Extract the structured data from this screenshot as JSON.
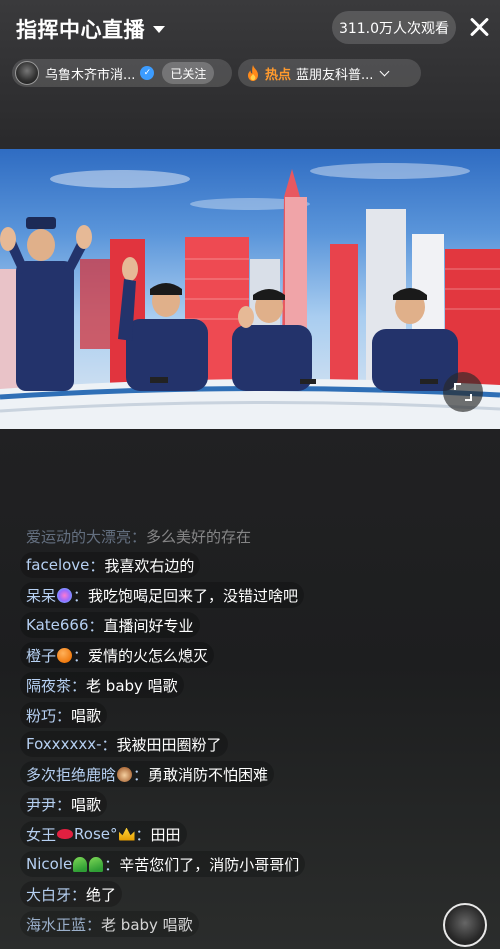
{
  "header": {
    "title": "指挥中心直播",
    "viewers": "311.0万人次观看"
  },
  "account": {
    "name": "乌鲁木齐市消...",
    "follow_label": "已关注"
  },
  "hot": {
    "label": "热点",
    "text": "蓝朋友科普..."
  },
  "icons": {
    "close": "close-icon",
    "dropdown": "caret-down-icon",
    "verified": "verified-icon",
    "fire": "fire-icon",
    "expand": "chevron-down-icon",
    "fullscreen": "fullscreen-icon"
  },
  "colors": {
    "username": "#b6d0f2",
    "hot_label": "#ff9a2e",
    "verified": "#3c9cff"
  },
  "comments": [
    {
      "user": "爱运动的大漂亮",
      "text": "多么美好的存在"
    },
    {
      "user": "facelove",
      "text": "我喜欢右边的"
    },
    {
      "user": "呆呆",
      "text": "我吃饱喝足回来了，没错过啥吧"
    },
    {
      "user": "Kate666",
      "text": "直播间好专业"
    },
    {
      "user": "橙子",
      "text": "爱情的火怎么熄灭"
    },
    {
      "user": "隔夜茶",
      "text": "老 baby 唱歌"
    },
    {
      "user": "粉巧",
      "text": "唱歌"
    },
    {
      "user": "Foxxxxxx-",
      "text": "我被田田圈粉了"
    },
    {
      "user": "多次拒绝鹿晗",
      "text": "勇敢消防不怕困难"
    },
    {
      "user": "尹尹",
      "text": "唱歌"
    },
    {
      "user": "女王",
      "user2": "Rose°",
      "text": "田田"
    },
    {
      "user": "Nicole",
      "text": "辛苦您们了，消防小哥哥们"
    },
    {
      "user": "大白牙",
      "text": "绝了"
    },
    {
      "user": "海水正蓝",
      "text": "老 baby 唱歌"
    }
  ]
}
